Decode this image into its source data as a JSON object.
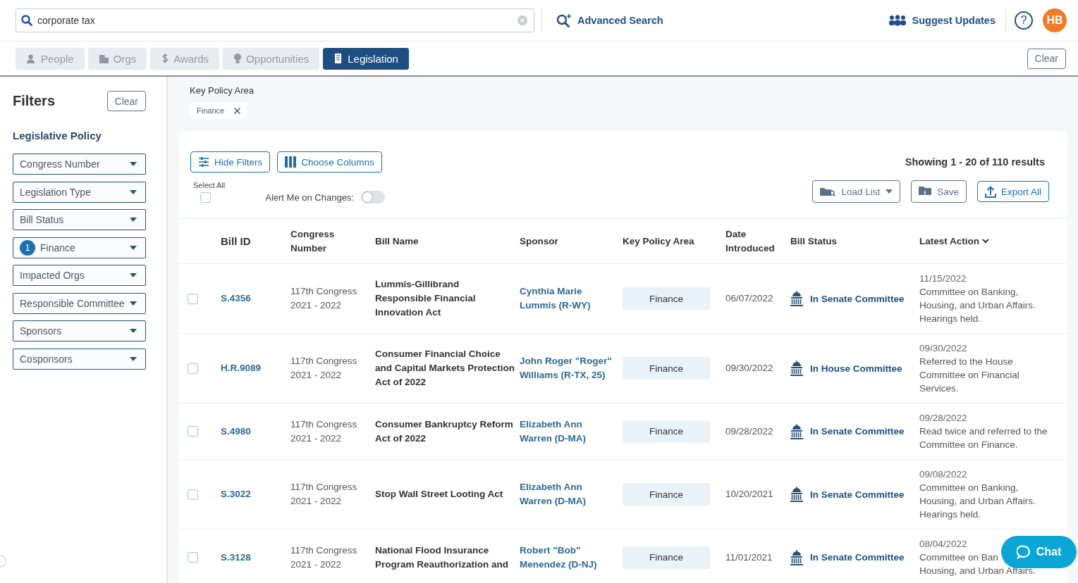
{
  "search": {
    "value": "corporate tax"
  },
  "header": {
    "advanced_search": "Advanced Search",
    "suggest_updates": "Suggest Updates",
    "help": "?",
    "avatar": "HB"
  },
  "tabs": [
    {
      "label": "People",
      "selected": false,
      "disabled": true
    },
    {
      "label": "Orgs",
      "selected": false,
      "disabled": true
    },
    {
      "label": "Awards",
      "selected": false,
      "disabled": true
    },
    {
      "label": "Opportunities",
      "selected": false,
      "disabled": true
    },
    {
      "label": "Legislation",
      "selected": true,
      "disabled": false
    }
  ],
  "tabs_clear": "Clear",
  "sidebar": {
    "title": "Filters",
    "clear": "Clear",
    "section": "Legislative Policy",
    "filters": [
      {
        "label": "Congress Number"
      },
      {
        "label": "Legislation Type"
      },
      {
        "label": "Bill Status"
      },
      {
        "label": "Finance",
        "count": "1"
      },
      {
        "label": "Impacted Orgs"
      },
      {
        "label": "Responsible Committee"
      },
      {
        "label": "Sponsors"
      },
      {
        "label": "Cosponsors"
      }
    ]
  },
  "active_filter": {
    "label": "Key Policy Area",
    "chips": [
      {
        "label": "Finance"
      }
    ]
  },
  "toolbar": {
    "hide_filters": "Hide Filters",
    "choose_columns": "Choose Columns",
    "results": "Showing 1 - 20 of 110 results",
    "select_all": "Select All",
    "select_all_checked": false,
    "alert_label": "Alert Me on Changes:",
    "alert_on": false,
    "load_list": "Load List",
    "save": "Save",
    "export_all": "Export All"
  },
  "table": {
    "columns": [
      "Bill ID",
      "Congress Number",
      "Bill Name",
      "Sponsor",
      "Key Policy Area",
      "Date Introduced",
      "Bill Status",
      "Latest Action"
    ],
    "rows": [
      {
        "checked": false,
        "bill_id": "S.4356",
        "congress": [
          "117th Congress",
          "2021 - 2022"
        ],
        "bill_name": "Lummis-Gillibrand Responsible Financial Innovation Act",
        "sponsor": "Cynthia Marie Lummis (R-WY)",
        "policy_area": "Finance",
        "date": "06/07/2022",
        "status": "In Senate Committee",
        "action_date": "11/15/2022",
        "action": [
          "Committee on Banking, Housing, and Urban Affairs. Hearings held."
        ]
      },
      {
        "checked": false,
        "bill_id": "H.R.9089",
        "congress": [
          "117th Congress",
          "2021 - 2022"
        ],
        "bill_name": "Consumer Financial Choice and Capital Markets Protection Act of 2022",
        "sponsor": "John Roger \"Roger\" Williams (R-TX, 25)",
        "policy_area": "Finance",
        "date": "09/30/2022",
        "status": "In House Committee",
        "action_date": "09/30/2022",
        "action": [
          "Referred to the House Committee on Financial Services."
        ]
      },
      {
        "checked": false,
        "bill_id": "S.4980",
        "congress": [
          "117th Congress",
          "2021 - 2022"
        ],
        "bill_name": "Consumer Bankruptcy Reform Act of 2022",
        "sponsor": "Elizabeth Ann Warren (D-MA)",
        "policy_area": "Finance",
        "date": "09/28/2022",
        "status": "In Senate Committee",
        "action_date": "09/28/2022",
        "action": [
          "Read twice and referred to the Committee on Finance."
        ]
      },
      {
        "checked": false,
        "bill_id": "S.3022",
        "congress": [
          "117th Congress",
          "2021 - 2022"
        ],
        "bill_name": "Stop Wall Street Looting Act",
        "sponsor": "Elizabeth Ann Warren (D-MA)",
        "policy_area": "Finance",
        "date": "10/20/2021",
        "status": "In Senate Committee",
        "action_date": "09/08/2022",
        "action": [
          "Committee on Banking, Housing, and Urban Affairs. Hearings held."
        ]
      },
      {
        "checked": false,
        "bill_id": "S.3128",
        "congress": [
          "117th Congress",
          "2021 - 2022"
        ],
        "bill_name": "National Flood Insurance Program Reauthorization and",
        "sponsor": "Robert \"Bob\" Menendez (D-NJ)",
        "policy_area": "Finance",
        "date": "11/01/2021",
        "status": "In Senate Committee",
        "action_date": "08/04/2022",
        "action": [
          "Committee on Ban",
          "Housing, and Urban Affairs."
        ]
      }
    ]
  },
  "chat": "Chat"
}
